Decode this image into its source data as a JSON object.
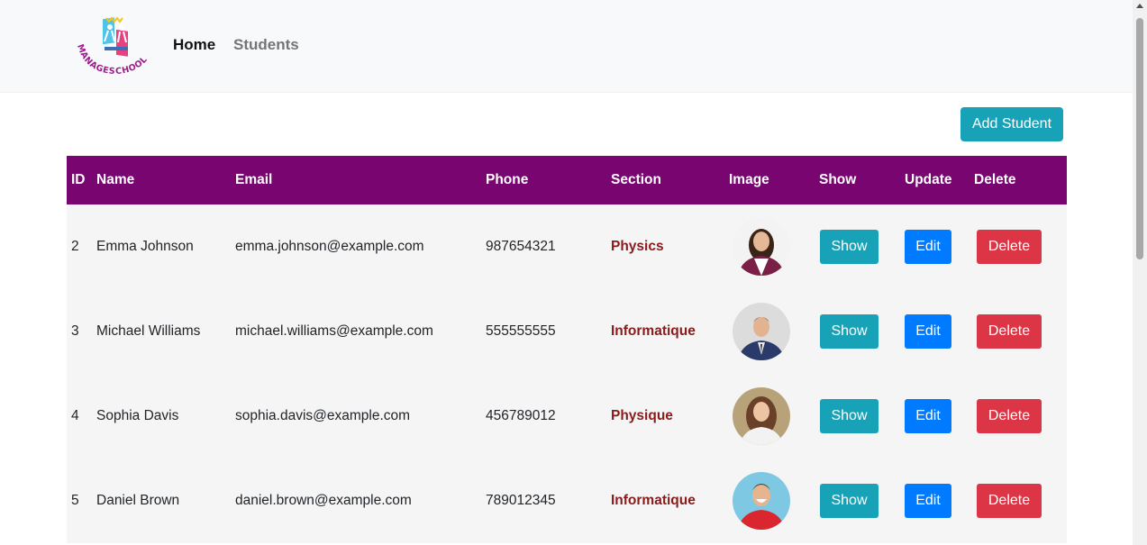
{
  "nav": {
    "logo_text": "MANAGESCHOOL",
    "home": "Home",
    "students": "Students"
  },
  "actions": {
    "add_student": "Add Student"
  },
  "table": {
    "headers": {
      "id": "ID",
      "name": "Name",
      "email": "Email",
      "phone": "Phone",
      "section": "Section",
      "image": "Image",
      "show": "Show",
      "update": "Update",
      "delete": "Delete"
    },
    "rows": [
      {
        "id": "2",
        "name": "Emma Johnson",
        "email": "emma.johnson@example.com",
        "phone": "987654321",
        "section": "Physics",
        "show": "Show",
        "edit": "Edit",
        "delete": "Delete"
      },
      {
        "id": "3",
        "name": "Michael Williams",
        "email": "michael.williams@example.com",
        "phone": "555555555",
        "section": "Informatique",
        "show": "Show",
        "edit": "Edit",
        "delete": "Delete"
      },
      {
        "id": "4",
        "name": "Sophia Davis",
        "email": "sophia.davis@example.com",
        "phone": "456789012",
        "section": "Physique",
        "show": "Show",
        "edit": "Edit",
        "delete": "Delete"
      },
      {
        "id": "5",
        "name": "Daniel Brown",
        "email": "daniel.brown@example.com",
        "phone": "789012345",
        "section": "Informatique",
        "show": "Show",
        "edit": "Edit",
        "delete": "Delete"
      }
    ]
  },
  "colors": {
    "header_bg": "#790570",
    "show_btn": "#17a2b8",
    "edit_btn": "#007bff",
    "delete_btn": "#dc3545",
    "section_text": "#8b1a1a"
  }
}
